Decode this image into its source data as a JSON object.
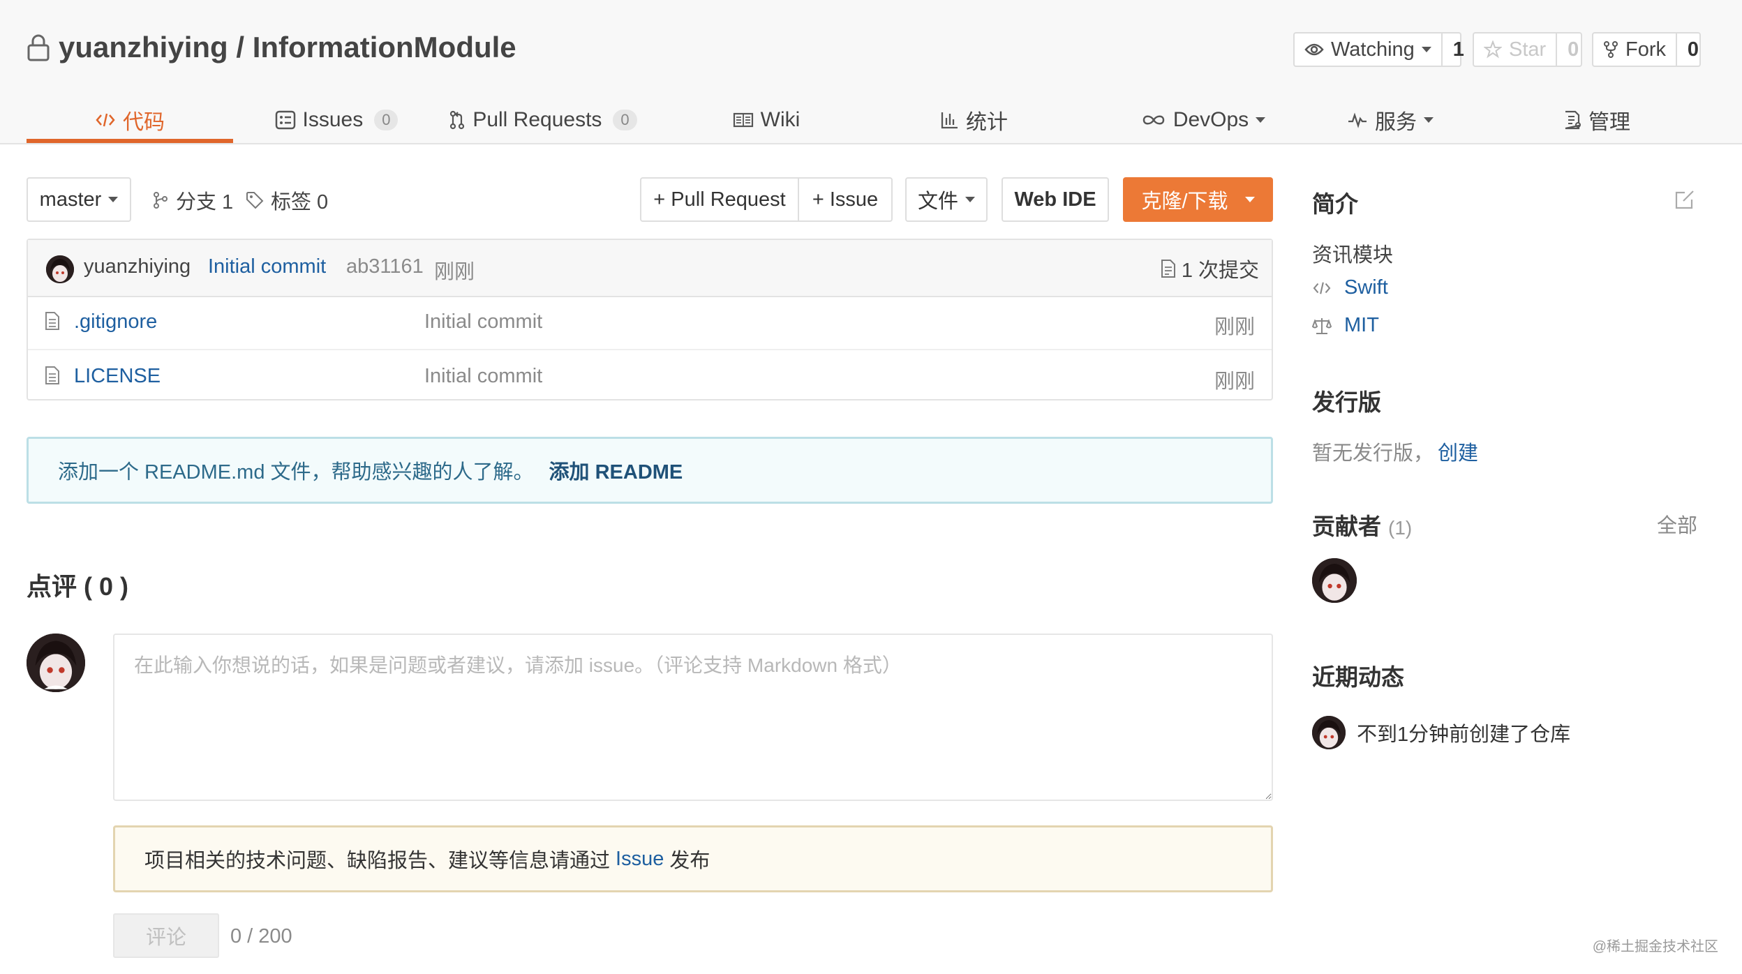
{
  "repo": {
    "title": "yuanzhiying / InformationModule"
  },
  "actions": {
    "watch": {
      "label": "Watching",
      "count": "1"
    },
    "star": {
      "label": "Star",
      "count": "0"
    },
    "fork": {
      "label": "Fork",
      "count": "0"
    }
  },
  "tabs": [
    {
      "label": "代码",
      "icon": "code-icon"
    },
    {
      "label": "Issues",
      "badge": "0",
      "icon": "issues-icon"
    },
    {
      "label": "Pull Requests",
      "badge": "0",
      "icon": "pull-request-icon"
    },
    {
      "label": "Wiki",
      "icon": "wiki-icon"
    },
    {
      "label": "统计",
      "icon": "chart-icon"
    },
    {
      "label": "DevOps",
      "icon": "infinity-icon"
    },
    {
      "label": "服务",
      "icon": "pulse-icon"
    },
    {
      "label": "管理",
      "icon": "manage-icon"
    }
  ],
  "toolbar": {
    "branch": "master",
    "branches_label": "分支 1",
    "tags_label": "标签 0",
    "pull_request_label": "+ Pull Request",
    "issue_label": "+ Issue",
    "file_label": "文件",
    "web_ide_label": "Web IDE",
    "clone_label": "克隆/下载"
  },
  "last_commit": {
    "author": "yuanzhiying",
    "message": "Initial commit",
    "hash": "ab31161",
    "time": "刚刚",
    "count_label": "1 次提交"
  },
  "files": [
    {
      "name": ".gitignore",
      "message": "Initial commit",
      "time": "刚刚"
    },
    {
      "name": "LICENSE",
      "message": "Initial commit",
      "time": "刚刚"
    }
  ],
  "readme_notice": {
    "text": "添加一个 README.md 文件，帮助感兴趣的人了解。",
    "link": "添加 README"
  },
  "comments": {
    "title": "点评 ( 0 )",
    "placeholder": "在此输入你想说的话，如果是问题或者建议，请添加 issue。（评论支持 Markdown 格式）",
    "notice_prefix": "项目相关的技术问题、缺陷报告、建议等信息请通过",
    "notice_link": "Issue",
    "notice_suffix": "发布",
    "submit_label": "评论",
    "char_count": "0 / 200"
  },
  "sidebar": {
    "intro_title": "简介",
    "description": "资讯模块",
    "language": "Swift",
    "license": "MIT",
    "releases_title": "发行版",
    "releases_empty": "暂无发行版，",
    "releases_create": "创建",
    "contributors_title": "贡献者",
    "contributors_count": "(1)",
    "contributors_all": "全部",
    "activity_title": "近期动态",
    "activity_item": "不到1分钟前创建了仓库"
  },
  "watermark": "@稀土掘金技术社区",
  "colors": {
    "accent": "#e0662b",
    "clone_button": "#ec7936",
    "link": "#1e5fa0"
  }
}
